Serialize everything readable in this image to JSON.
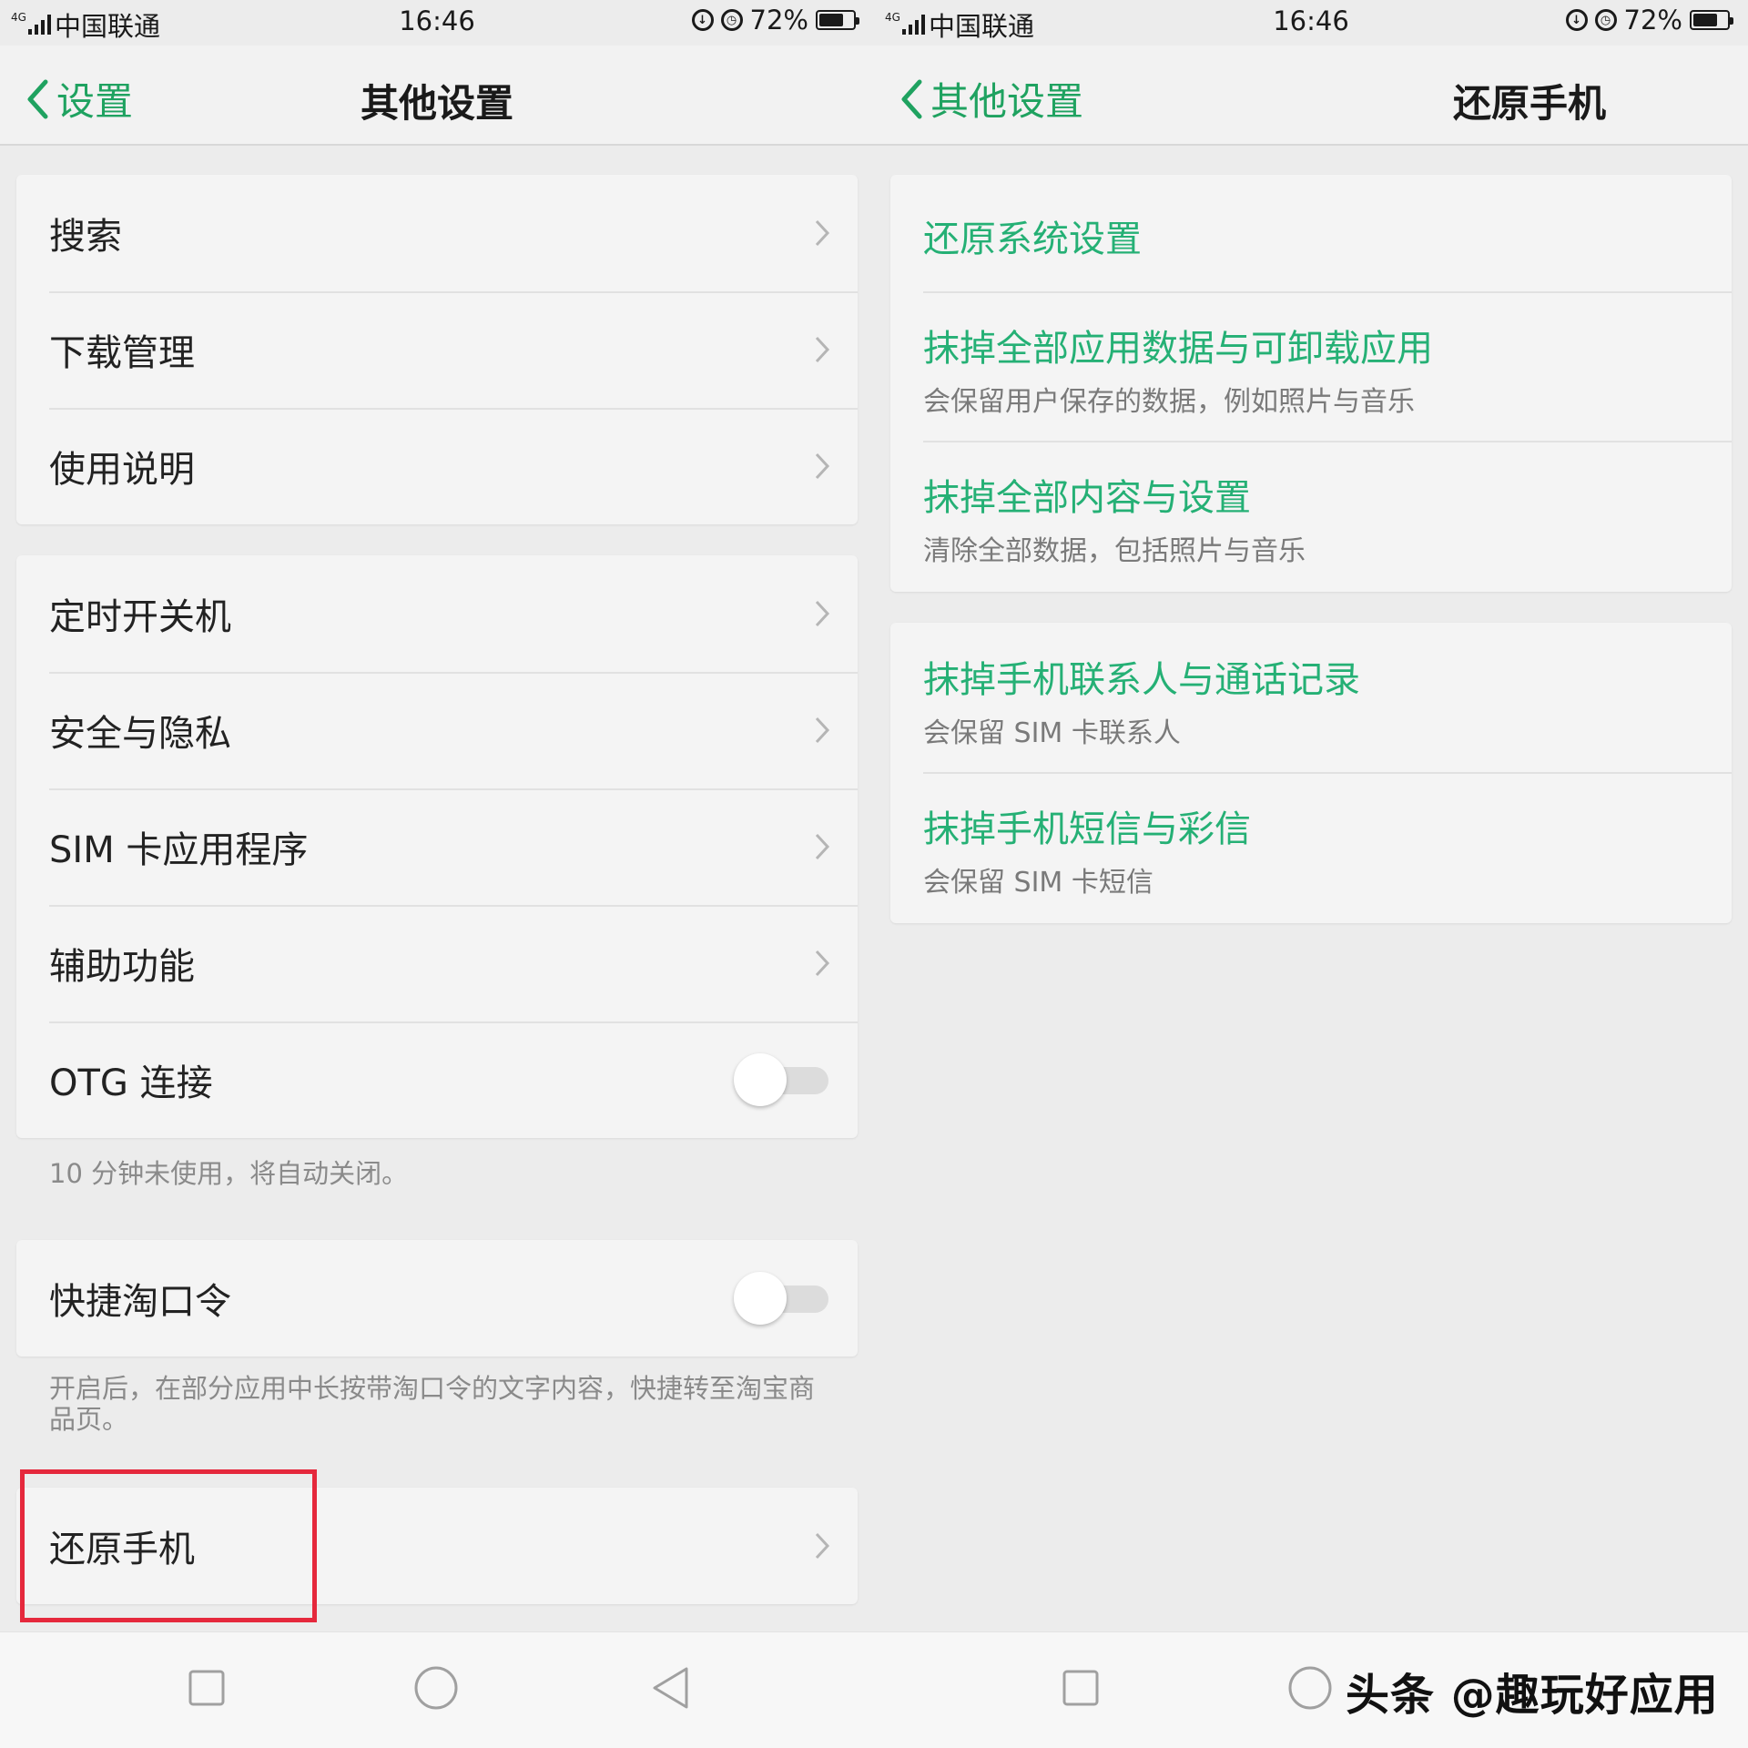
{
  "status_bar": {
    "network": "4G",
    "carrier": "中国联通",
    "time": "16:46",
    "battery": "72%",
    "battery_level": 0.72,
    "icons": [
      "lock-rotation-icon",
      "alarm-icon",
      "battery-icon"
    ]
  },
  "left_screen": {
    "back_label": "设置",
    "title": "其他设置",
    "group1": [
      {
        "label": "搜索"
      },
      {
        "label": "下载管理"
      },
      {
        "label": "使用说明"
      }
    ],
    "group2": [
      {
        "label": "定时开关机"
      },
      {
        "label": "安全与隐私"
      },
      {
        "label": "SIM 卡应用程序"
      },
      {
        "label": "辅助功能"
      },
      {
        "label": "OTG 连接",
        "toggle": "off"
      }
    ],
    "otg_note": "10 分钟未使用，将自动关闭。",
    "taobao": {
      "label": "快捷淘口令",
      "toggle": "off"
    },
    "taobao_note": "开启后，在部分应用中长按带淘口令的文字内容，快捷转至淘宝商品页。",
    "restore": {
      "label": "还原手机"
    }
  },
  "right_screen": {
    "back_label": "其他设置",
    "title": "还原手机",
    "group1": [
      {
        "title": "还原系统设置",
        "subtitle": ""
      },
      {
        "title": "抹掉全部应用数据与可卸载应用",
        "subtitle": "会保留用户保存的数据，例如照片与音乐"
      },
      {
        "title": "抹掉全部内容与设置",
        "subtitle": "清除全部数据，包括照片与音乐"
      }
    ],
    "group2": [
      {
        "title": "抹掉手机联系人与通话记录",
        "subtitle": "会保留 SIM 卡联系人"
      },
      {
        "title": "抹掉手机短信与彩信",
        "subtitle": "会保留 SIM 卡短信"
      }
    ]
  },
  "watermark": "头条 @趣玩好应用",
  "colors": {
    "accent_green": "#25b075",
    "back_green": "#1fa260",
    "highlight_red": "#e5283c",
    "background": "#ececec",
    "card": "#f4f4f4"
  }
}
